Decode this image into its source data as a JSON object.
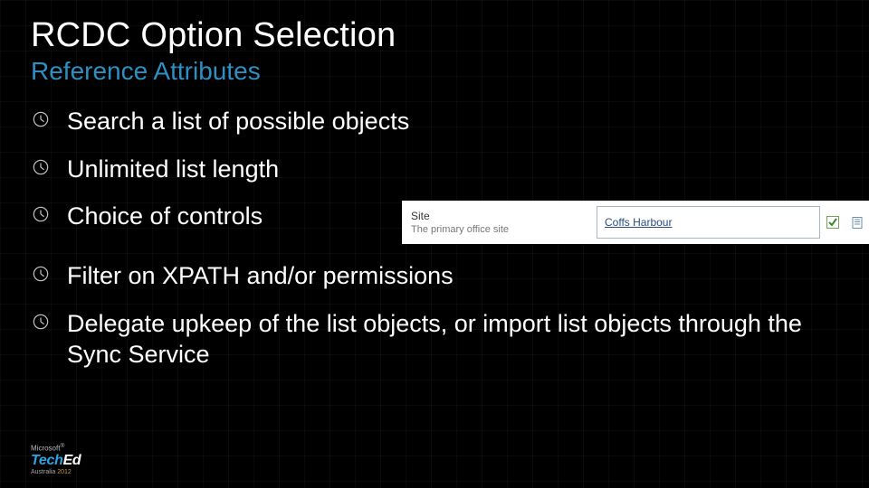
{
  "title": "RCDC Option Selection",
  "subtitle": "Reference Attributes",
  "bullets": [
    "Search a list of possible objects",
    "Unlimited list length",
    "Choice of controls",
    "Filter on XPATH and/or permissions",
    "Delegate upkeep of the list objects, or import list objects through the Sync Service"
  ],
  "form": {
    "label": "Site",
    "description": "The primary office site",
    "value": "Coffs Harbour"
  },
  "footer": {
    "vendor": "Microsoft",
    "brand_a": "Tech",
    "brand_b": "Ed",
    "region": "Australia",
    "year": "2012"
  }
}
